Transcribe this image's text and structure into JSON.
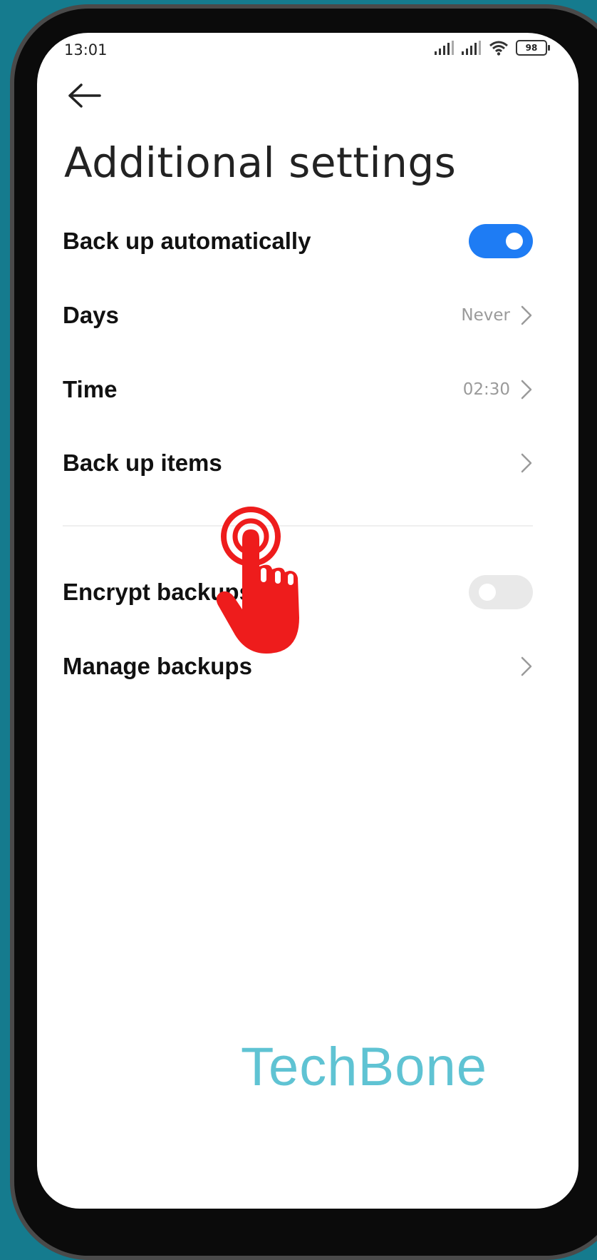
{
  "status_bar": {
    "time": "13:01",
    "battery": "98"
  },
  "page": {
    "title": "Additional settings"
  },
  "settings": [
    {
      "label": "Back up automatically",
      "control": "toggle",
      "state": "on"
    },
    {
      "label": "Days",
      "value": "Never",
      "control": "chevron"
    },
    {
      "label": "Time",
      "value": "02:30",
      "control": "chevron"
    },
    {
      "label": "Back up items",
      "control": "chevron"
    },
    {
      "label": "Encrypt backups",
      "control": "toggle",
      "state": "off"
    },
    {
      "label": "Manage backups",
      "control": "chevron"
    }
  ],
  "watermark": "TechBone",
  "colors": {
    "accent": "#1e7cf4",
    "background": "#157b8e",
    "watermark": "#5fc3d3",
    "tap_indicator": "#ee1c1c"
  },
  "icons": [
    "back-arrow-icon",
    "chevron-right-icon",
    "signal-icon",
    "wifi-icon",
    "battery-icon",
    "tap-hand-icon"
  ]
}
